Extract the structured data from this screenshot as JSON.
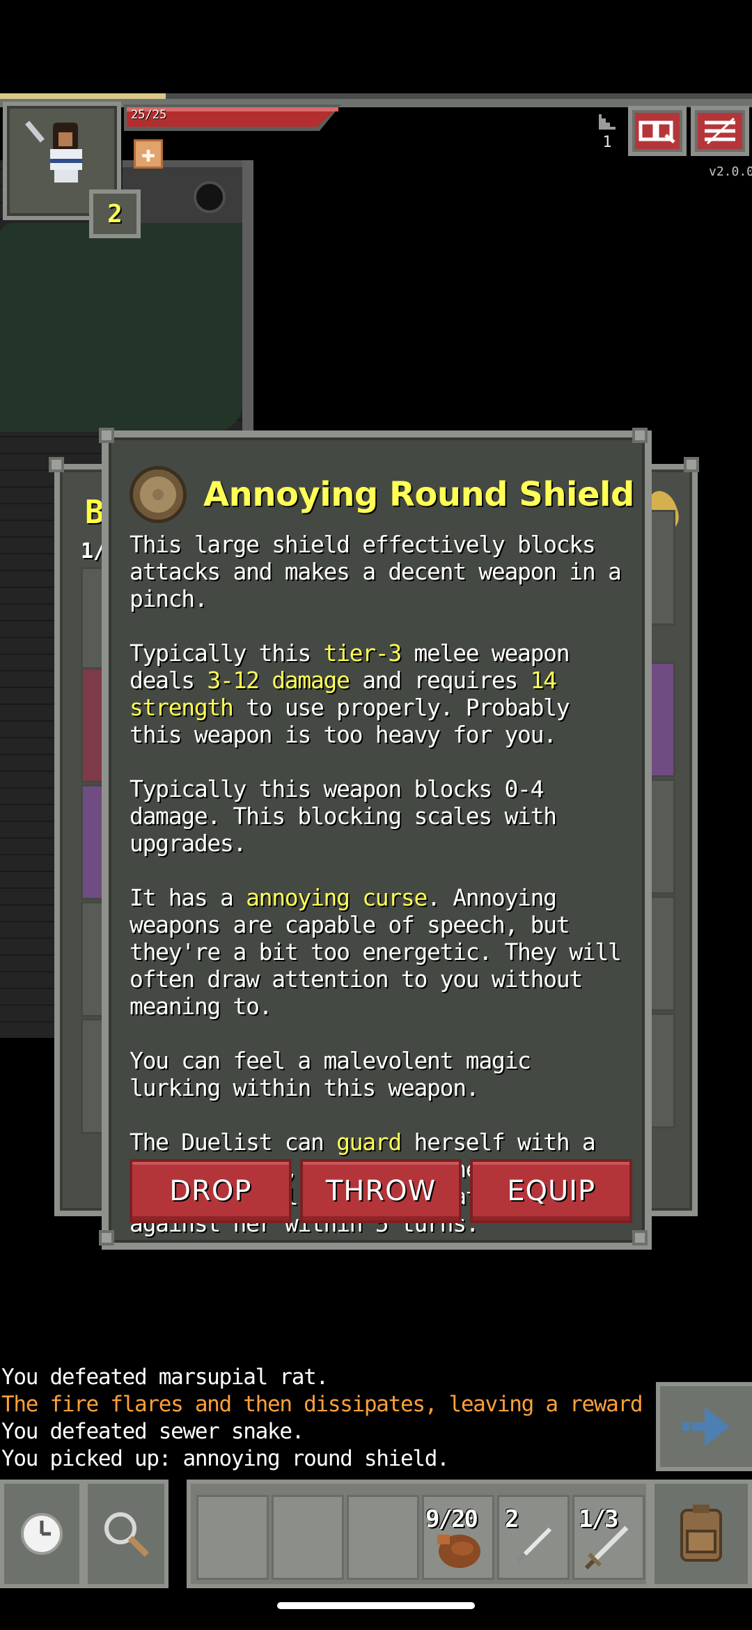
{
  "hud": {
    "hp_text": "25/25",
    "hero_level": "2",
    "depth": "1",
    "version": "v2.0.0",
    "xp_progress": 0.22,
    "buff_icon": "medic-cross-icon"
  },
  "inventory_bg": {
    "title_partial": "Ba",
    "count_partial": "1/"
  },
  "item": {
    "title": "Annoying Round Shield",
    "icon": "round-shield-icon",
    "description": {
      "p1": "This large shield effectively blocks attacks and makes a decent weapon in a pinch.",
      "p2": {
        "a": "Typically this ",
        "tier": "tier-3",
        "b": " melee weapon deals ",
        "damage": "3-12 damage",
        "c": " and requires ",
        "strength": "14 strength",
        "d": " to use properly. Probably this weapon is too heavy for you."
      },
      "p3": "Typically this weapon blocks 0-4 damage. This blocking scales with upgrades.",
      "p4": {
        "a": "It has a ",
        "curse": "annoying curse",
        "b": ". Annoying weapons are capable of speech, but they're a bit too energetic. They will often draw attention to you without meaning to."
      },
      "p5": "You can feel a malevolent magic lurking within this weapon.",
      "p6": {
        "a": "The Duelist can ",
        "guard": "guard",
        "b": " herself with a round shield, completely negating the next physical or magical attack made against her within 5 turns."
      }
    },
    "actions": {
      "drop": "DROP",
      "throw": "THROW",
      "equip": "EQUIP"
    }
  },
  "log": [
    {
      "text": "You defeated marsupial rat.",
      "color": "#ffffff"
    },
    {
      "text": "The fire flares and then dissipates, leaving a reward behind!",
      "color": "#ffa03a"
    },
    {
      "text": "You defeated sewer snake.",
      "color": "#ffffff"
    },
    {
      "text": "You picked up: annoying round shield.",
      "color": "#ffffff"
    }
  ],
  "toolbar": {
    "wait_icon": "clock-icon",
    "search_icon": "magnifier-icon",
    "slot_waterskin_label": "9/20",
    "slot_darts_label": "2",
    "slot_sword_label": "1/3",
    "backpack_icon": "backpack-icon",
    "resume_icon": "resume-arrow-icon"
  },
  "colors": {
    "highlight": "#ffff55",
    "warning": "#ffa03a",
    "button_red": "#b3353a",
    "panel": "#454943",
    "frame": "#8f928c"
  }
}
